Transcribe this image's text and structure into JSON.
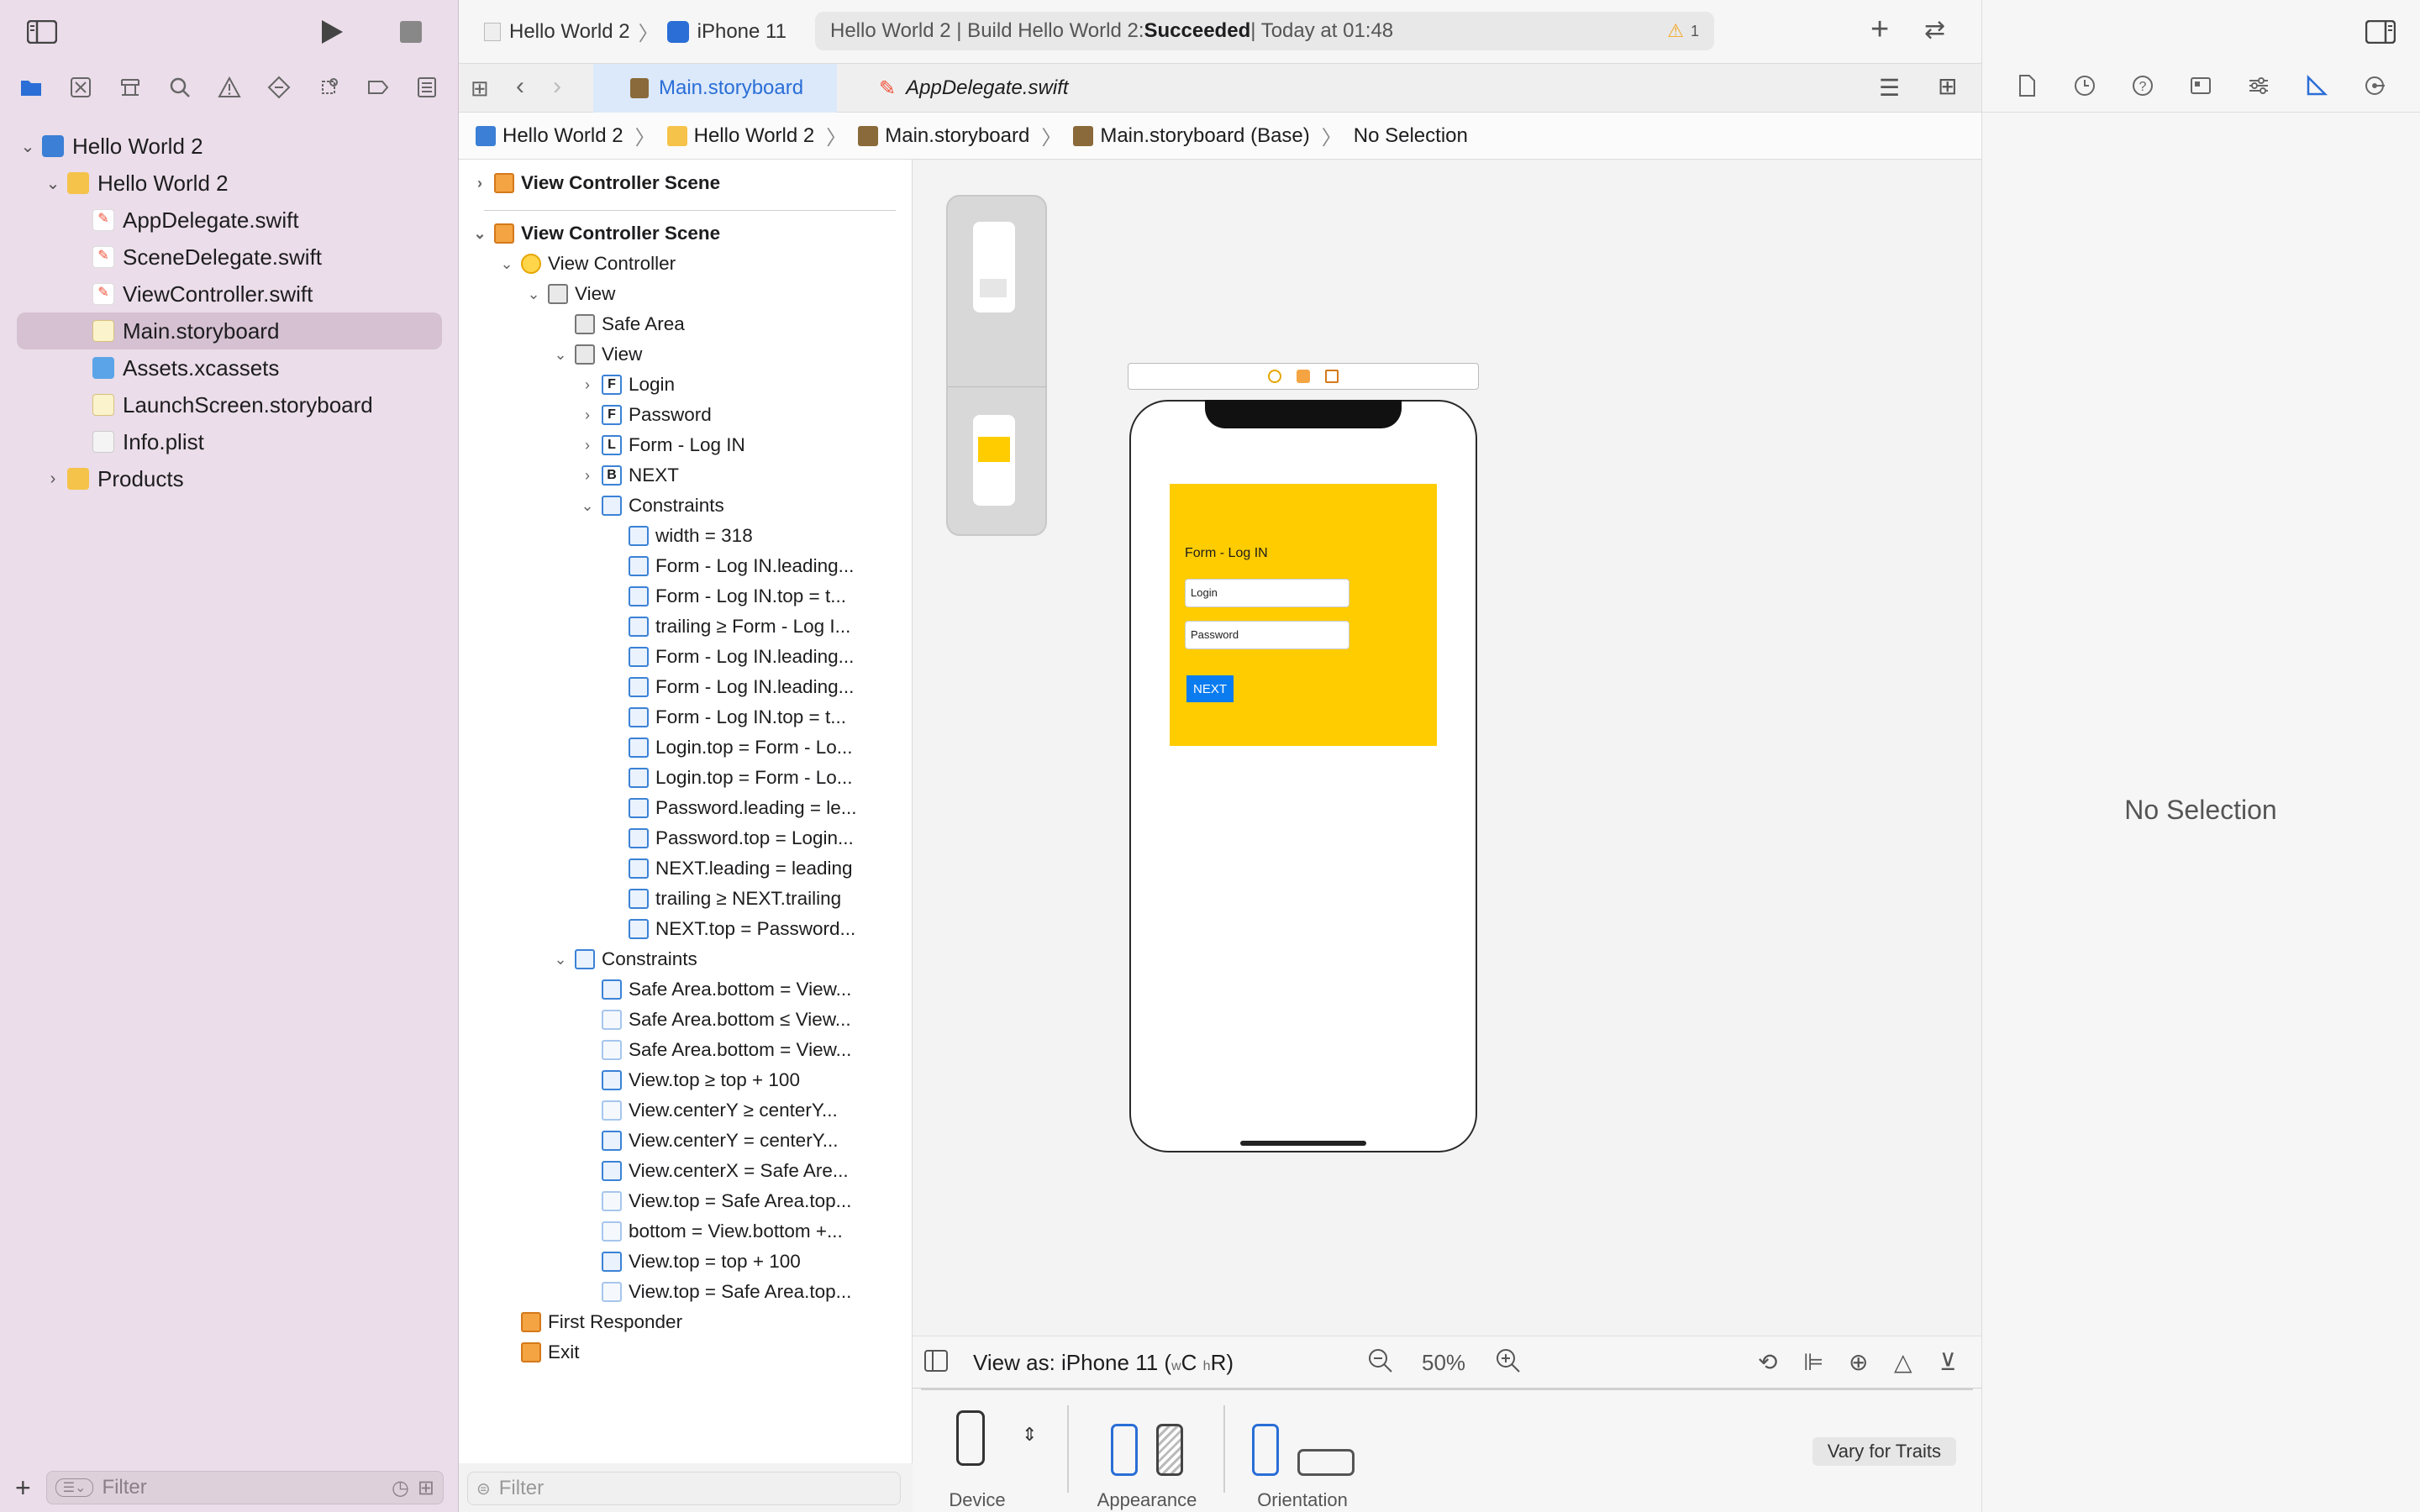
{
  "toolbar": {
    "scheme_project": "Hello World 2",
    "scheme_device": "iPhone 11",
    "status_text": "Hello World 2 | Build Hello World 2: ",
    "status_result": "Succeeded",
    "status_time": " | Today at 01:48",
    "warning_count": "1"
  },
  "navigator": {
    "items": [
      {
        "label": "Hello World 2",
        "icon": "xcode-project-icon",
        "level": 0,
        "disclosure": "open"
      },
      {
        "label": "Hello World 2",
        "icon": "folder-icon",
        "level": 1,
        "disclosure": "open"
      },
      {
        "label": "AppDelegate.swift",
        "icon": "swift-file-icon",
        "level": 2
      },
      {
        "label": "SceneDelegate.swift",
        "icon": "swift-file-icon",
        "level": 2
      },
      {
        "label": "ViewController.swift",
        "icon": "swift-file-icon",
        "level": 2
      },
      {
        "label": "Main.storyboard",
        "icon": "storyboard-file-icon",
        "level": 2,
        "selected": true
      },
      {
        "label": "Assets.xcassets",
        "icon": "assets-folder-icon",
        "level": 2
      },
      {
        "label": "LaunchScreen.storyboard",
        "icon": "storyboard-file-icon",
        "level": 2
      },
      {
        "label": "Info.plist",
        "icon": "plist-file-icon",
        "level": 2
      },
      {
        "label": "Products",
        "icon": "folder-icon",
        "level": 1,
        "disclosure": "closed"
      }
    ],
    "filter_placeholder": "Filter"
  },
  "tabs": {
    "main_storyboard": "Main.storyboard",
    "app_delegate": "AppDelegate.swift"
  },
  "breadcrumb": {
    "project": "Hello World 2",
    "group": "Hello World 2",
    "file": "Main.storyboard",
    "base": "Main.storyboard (Base)",
    "selection": "No Selection"
  },
  "outline": {
    "rows": [
      {
        "label": "View Controller Scene",
        "icon": "scene",
        "level": 0,
        "disc": "closed",
        "bold": true
      },
      {
        "label": "View Controller Scene",
        "icon": "scene",
        "level": 0,
        "disc": "open",
        "bold": true
      },
      {
        "label": "View Controller",
        "icon": "vc",
        "level": 1,
        "disc": "open"
      },
      {
        "label": "View",
        "icon": "view",
        "level": 2,
        "disc": "open"
      },
      {
        "label": "Safe Area",
        "icon": "safe",
        "level": 3
      },
      {
        "label": "View",
        "icon": "view",
        "level": 3,
        "disc": "open"
      },
      {
        "label": "Login",
        "icon": "F",
        "level": 4,
        "disc": "closed"
      },
      {
        "label": "Password",
        "icon": "F",
        "level": 4,
        "disc": "closed"
      },
      {
        "label": "Form - Log IN",
        "icon": "L",
        "level": 4,
        "disc": "closed"
      },
      {
        "label": "NEXT",
        "icon": "B",
        "level": 4,
        "disc": "closed"
      },
      {
        "label": "Constraints",
        "icon": "cons",
        "level": 4,
        "disc": "open"
      },
      {
        "label": "width = 318",
        "icon": "c",
        "level": 5
      },
      {
        "label": "Form - Log IN.leading...",
        "icon": "c",
        "level": 5
      },
      {
        "label": "Form - Log IN.top = t...",
        "icon": "c",
        "level": 5
      },
      {
        "label": "trailing ≥ Form - Log I...",
        "icon": "c",
        "level": 5
      },
      {
        "label": "Form - Log IN.leading...",
        "icon": "c",
        "level": 5
      },
      {
        "label": "Form - Log IN.leading...",
        "icon": "c",
        "level": 5
      },
      {
        "label": "Form - Log IN.top = t...",
        "icon": "c",
        "level": 5
      },
      {
        "label": "Login.top = Form - Lo...",
        "icon": "c",
        "level": 5
      },
      {
        "label": "Login.top = Form - Lo...",
        "icon": "c",
        "level": 5
      },
      {
        "label": "Password.leading = le...",
        "icon": "c",
        "level": 5
      },
      {
        "label": "Password.top = Login...",
        "icon": "c",
        "level": 5
      },
      {
        "label": "NEXT.leading = leading",
        "icon": "c",
        "level": 5
      },
      {
        "label": "trailing ≥ NEXT.trailing",
        "icon": "c",
        "level": 5
      },
      {
        "label": "NEXT.top = Password...",
        "icon": "c",
        "level": 5
      },
      {
        "label": "Constraints",
        "icon": "cons",
        "level": 3,
        "disc": "open"
      },
      {
        "label": "Safe Area.bottom = View...",
        "icon": "c",
        "level": 4
      },
      {
        "label": "Safe Area.bottom ≤ View...",
        "icon": "cf",
        "level": 4
      },
      {
        "label": "Safe Area.bottom = View...",
        "icon": "cf",
        "level": 4
      },
      {
        "label": "View.top ≥ top + 100",
        "icon": "c",
        "level": 4
      },
      {
        "label": "View.centerY ≥ centerY...",
        "icon": "cf",
        "level": 4
      },
      {
        "label": "View.centerY = centerY...",
        "icon": "c",
        "level": 4
      },
      {
        "label": "View.centerX = Safe Are...",
        "icon": "c",
        "level": 4
      },
      {
        "label": "View.top = Safe Area.top...",
        "icon": "cf",
        "level": 4
      },
      {
        "label": "bottom = View.bottom +...",
        "icon": "cf",
        "level": 4
      },
      {
        "label": "View.top = top + 100",
        "icon": "c",
        "level": 4
      },
      {
        "label": "View.top = Safe Area.top...",
        "icon": "cf",
        "level": 4
      },
      {
        "label": "First Responder",
        "icon": "responder",
        "level": 1
      },
      {
        "label": "Exit",
        "icon": "exit",
        "level": 1
      }
    ],
    "filter_placeholder": "Filter"
  },
  "canvas": {
    "form_label": "Form - Log IN",
    "login_placeholder": "Login",
    "password_placeholder": "Password",
    "next_button": "NEXT"
  },
  "viewas": {
    "label": "View as: iPhone 11 (",
    "w": "w",
    "c": "C",
    "h": "h",
    "r": "R",
    "close": ")",
    "zoom": "50%"
  },
  "devicebar": {
    "device_label": "Device",
    "appearance_label": "Appearance",
    "orientation_label": "Orientation",
    "vary_button": "Vary for Traits"
  },
  "inspector": {
    "no_selection": "No Selection"
  },
  "colors": {
    "accent": "#2a6ed6",
    "form_background": "#ffcc00",
    "button_blue": "#0a7cf0",
    "warning": "#f5a623"
  }
}
